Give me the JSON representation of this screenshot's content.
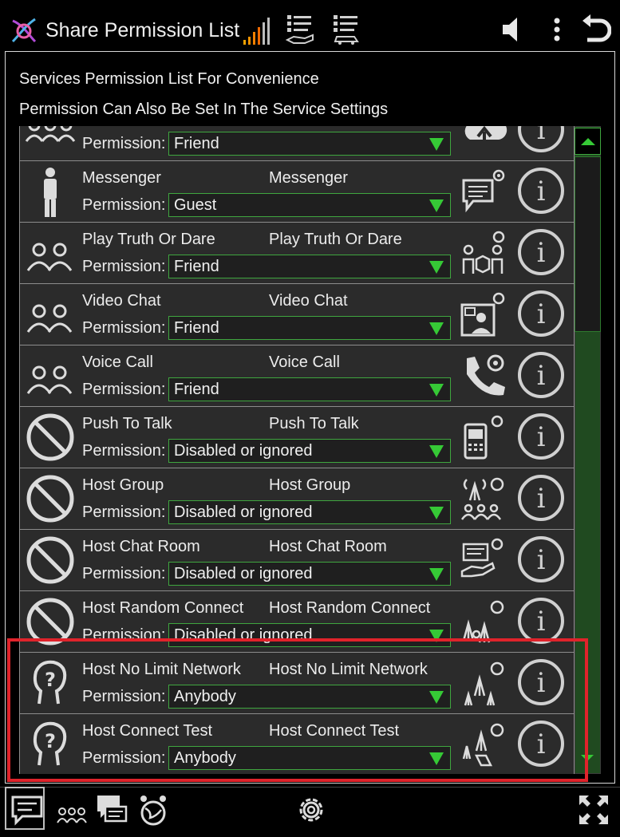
{
  "header": {
    "title": "Share Permission List",
    "icons": [
      "app-logo-icon",
      "signal-strength-icon",
      "list-share-icon",
      "list-car-icon",
      "volume-icon",
      "more-vert-icon",
      "back-icon"
    ]
  },
  "info": {
    "line1": "Services Permission List For Convenience",
    "line2": "Permission Can Also Be Set In The Service Settings"
  },
  "permission_label": "Permission:",
  "rows": [
    {
      "name": "",
      "name2": "",
      "permission": "Friend",
      "icon": "group-icon",
      "service_icon": "cloud-upload-icon"
    },
    {
      "name": "Messenger",
      "name2": "Messenger",
      "permission": "Guest",
      "icon": "person-icon",
      "service_icon": "message-settings-icon"
    },
    {
      "name": "Play Truth Or Dare",
      "name2": "Play Truth Or Dare",
      "permission": "Friend",
      "icon": "group-icon",
      "service_icon": "game-settings-icon"
    },
    {
      "name": "Video Chat",
      "name2": "Video Chat",
      "permission": "Friend",
      "icon": "group-icon",
      "service_icon": "video-chat-settings-icon"
    },
    {
      "name": "Voice Call",
      "name2": "Voice Call",
      "permission": "Friend",
      "icon": "group-icon",
      "service_icon": "phone-settings-icon"
    },
    {
      "name": "Push To Talk",
      "name2": "Push To Talk",
      "permission": "Disabled or ignored",
      "icon": "disabled-icon",
      "service_icon": "walkie-talkie-settings-icon"
    },
    {
      "name": "Host Group",
      "name2": "Host Group",
      "permission": "Disabled or ignored",
      "icon": "disabled-icon",
      "service_icon": "host-group-settings-icon"
    },
    {
      "name": "Host Chat Room",
      "name2": "Host Chat Room",
      "permission": "Disabled or ignored",
      "icon": "disabled-icon",
      "service_icon": "chat-room-settings-icon"
    },
    {
      "name": "Host Random Connect",
      "name2": "Host Random Connect",
      "permission": "Disabled or ignored",
      "icon": "disabled-icon",
      "service_icon": "random-connect-settings-icon"
    },
    {
      "name": "Host No Limit Network",
      "name2": "Host No Limit Network",
      "permission": "Anybody",
      "icon": "anybody-icon",
      "service_icon": "network-settings-icon"
    },
    {
      "name": "Host Connect Test",
      "name2": "Host Connect Test",
      "permission": "Anybody",
      "icon": "anybody-icon",
      "service_icon": "connect-test-settings-icon"
    }
  ],
  "info_button_glyph": "i",
  "footer": {
    "icons": [
      "chat-icon",
      "group-chat-icon",
      "messages-icon",
      "globe-person-icon",
      "settings-icon",
      "fullscreen-icon"
    ]
  },
  "colors": {
    "accent": "#36c936",
    "highlight": "#e0232b",
    "row_bg": "#2b2b2b"
  }
}
